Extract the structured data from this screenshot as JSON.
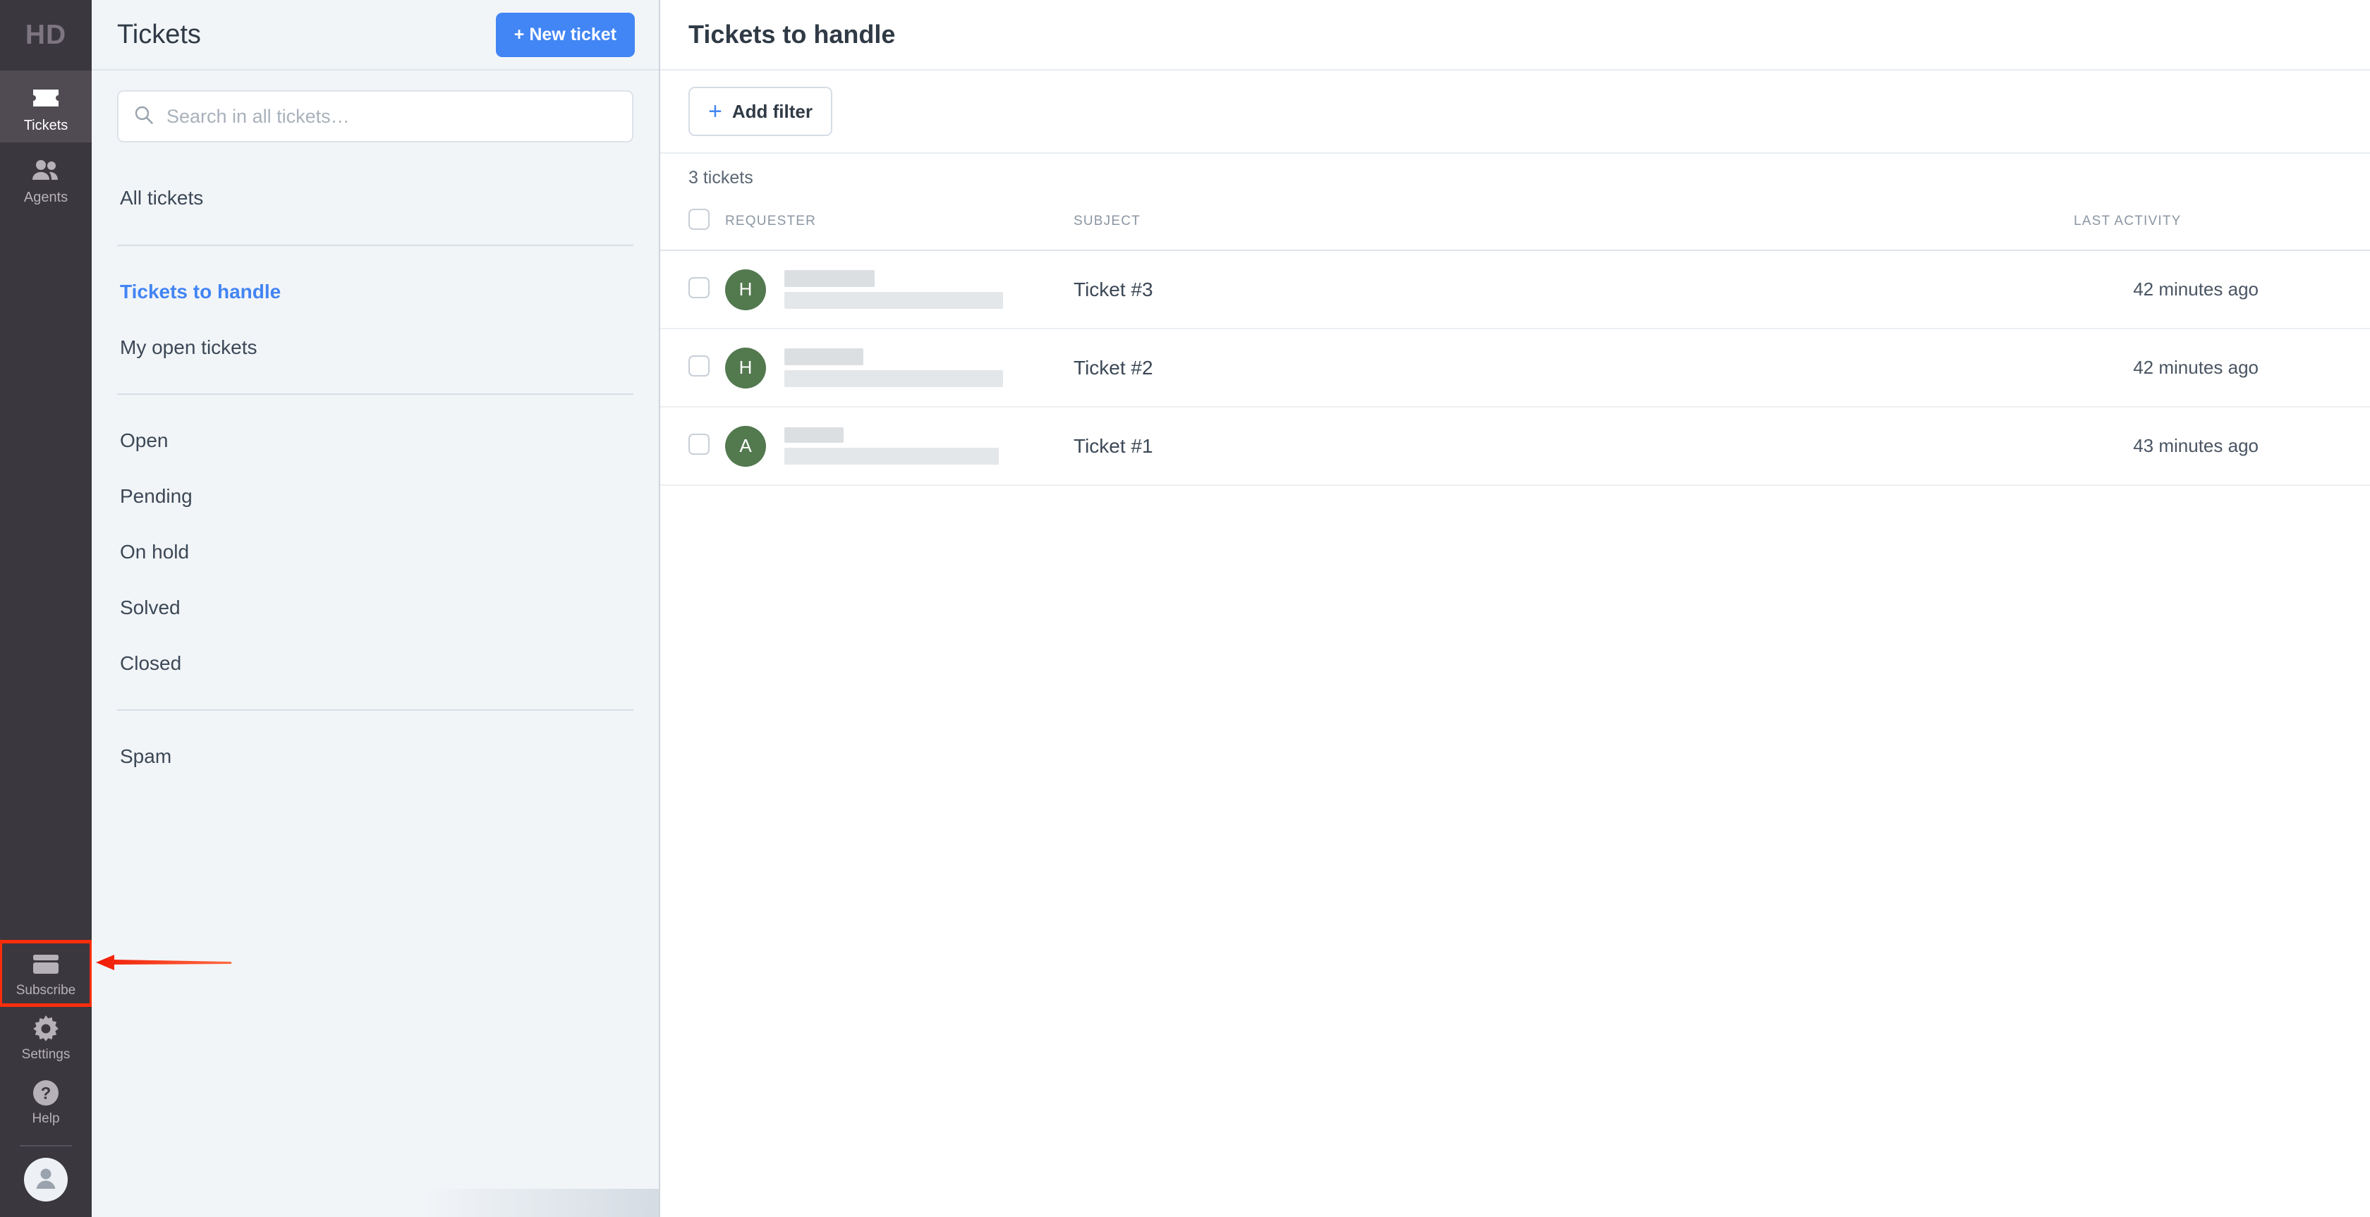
{
  "rail": {
    "logo": "HD",
    "items": [
      {
        "label": "Tickets",
        "icon": "ticket-icon",
        "active": true
      },
      {
        "label": "Agents",
        "icon": "agents-icon",
        "active": false
      }
    ],
    "bottom_items": [
      {
        "label": "Subscribe",
        "icon": "credit-card-icon",
        "highlighted": true
      },
      {
        "label": "Settings",
        "icon": "gear-icon",
        "highlighted": false
      },
      {
        "label": "Help",
        "icon": "question-circle-icon",
        "highlighted": false
      }
    ],
    "avatar_icon": "user-avatar-icon"
  },
  "panel": {
    "title": "Tickets",
    "new_ticket_label": "+ New ticket",
    "search": {
      "placeholder": "Search in all tickets…",
      "value": ""
    },
    "groups": [
      {
        "items": [
          {
            "label": "All tickets",
            "active": false
          }
        ]
      },
      {
        "items": [
          {
            "label": "Tickets to handle",
            "active": true
          },
          {
            "label": "My open tickets",
            "active": false
          }
        ]
      },
      {
        "items": [
          {
            "label": "Open",
            "active": false
          },
          {
            "label": "Pending",
            "active": false
          },
          {
            "label": "On hold",
            "active": false
          },
          {
            "label": "Solved",
            "active": false
          },
          {
            "label": "Closed",
            "active": false
          }
        ]
      },
      {
        "items": [
          {
            "label": "Spam",
            "active": false
          }
        ]
      }
    ]
  },
  "main": {
    "title": "Tickets to handle",
    "add_filter_label": "Add filter",
    "plus_symbol": "+",
    "ticket_count": "3 tickets",
    "columns": {
      "requester": "REQUESTER",
      "subject": "SUBJECT",
      "last_activity": "LAST ACTIVITY"
    },
    "rows": [
      {
        "avatar_initial": "H",
        "requester_redacted": true,
        "subject": "Ticket #3",
        "last_activity": "42 minutes ago"
      },
      {
        "avatar_initial": "H",
        "requester_redacted": true,
        "subject": "Ticket #2",
        "last_activity": "42 minutes ago"
      },
      {
        "avatar_initial": "A",
        "requester_redacted": true,
        "subject": "Ticket #1",
        "last_activity": "43 minutes ago"
      }
    ]
  },
  "colors": {
    "rail_bg": "#3b373e",
    "rail_active": "#504b53",
    "panel_bg": "#f2f5f8",
    "accent_blue": "#4285f4",
    "avatar_green": "#53794f",
    "annotation_red": "#fc2d0a"
  }
}
